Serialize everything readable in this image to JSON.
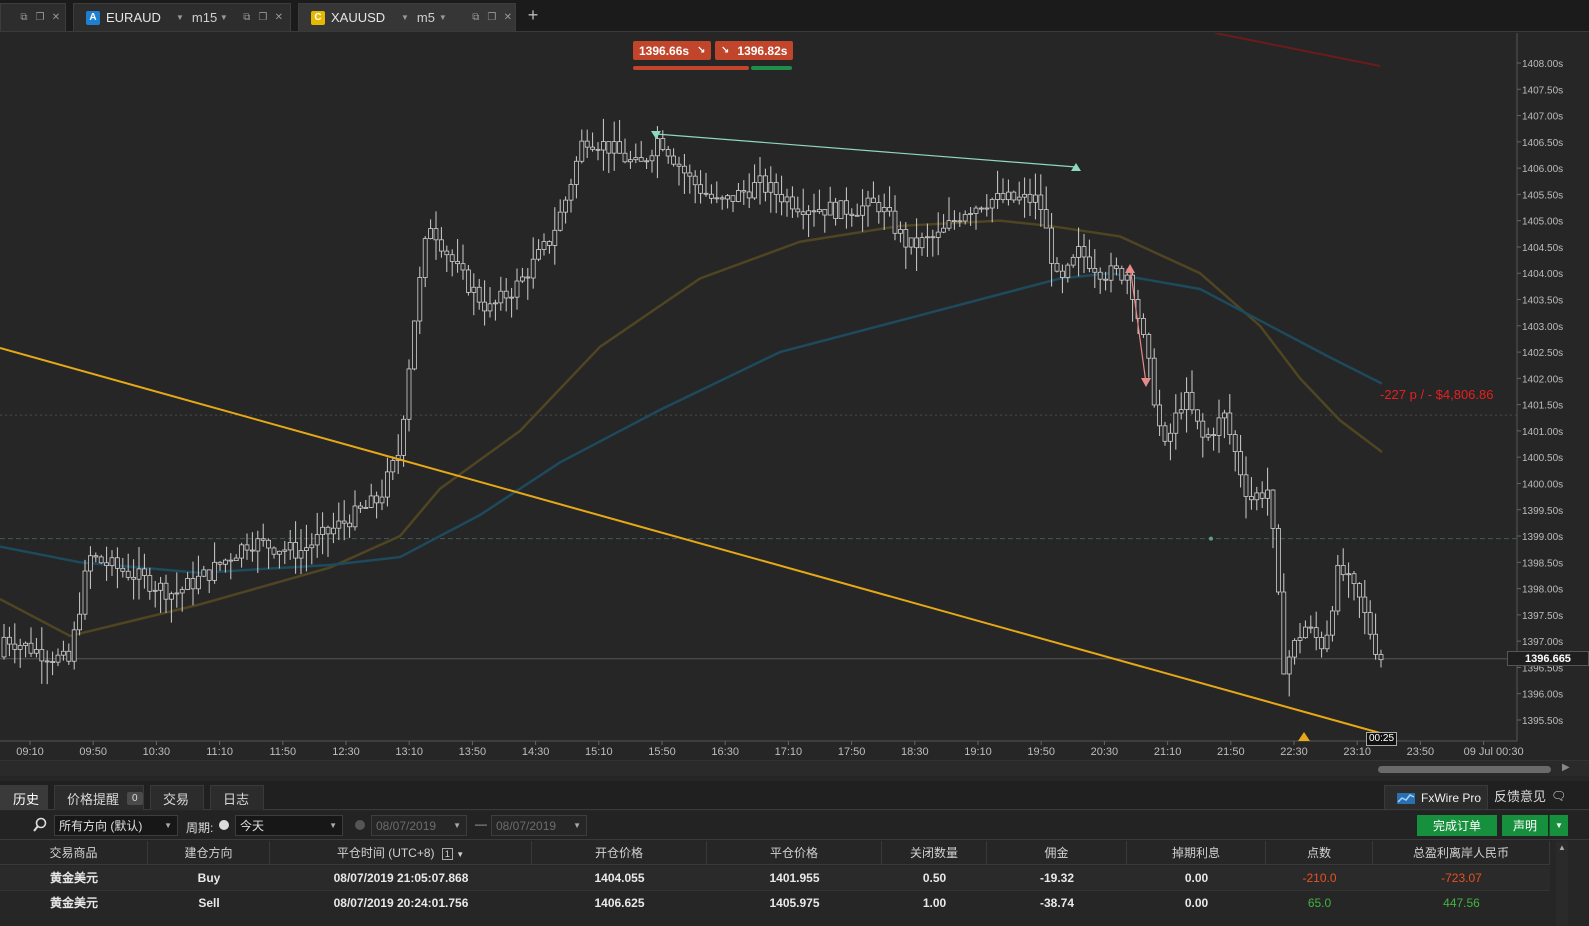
{
  "tabs": [
    {
      "badge": "",
      "symbol": "",
      "timeframe": ""
    },
    {
      "badge": "A",
      "symbol": "EURAUD",
      "timeframe": "m15",
      "badge_color": "#1e7fd1"
    },
    {
      "badge": "C",
      "symbol": "XAUUSD",
      "timeframe": "m5",
      "badge_color": "#e6b800"
    }
  ],
  "chart": {
    "bid_label": "1396.66s",
    "ask_label": "1396.82s",
    "pl_label": "-227 p / - $4,806.86",
    "current_price": "1396.665",
    "timer": "00:25",
    "price_axis": [
      "1408.00s",
      "1407.50s",
      "1407.00s",
      "1406.50s",
      "1406.00s",
      "1405.50s",
      "1405.00s",
      "1404.50s",
      "1404.00s",
      "1403.50s",
      "1403.00s",
      "1402.50s",
      "1402.00s",
      "1401.50s",
      "1401.00s",
      "1400.50s",
      "1400.00s",
      "1399.50s",
      "1399.00s",
      "1398.50s",
      "1398.00s",
      "1397.50s",
      "1397.00s",
      "1396.50s",
      "1396.00s",
      "1395.50s"
    ],
    "time_axis": [
      "09:10",
      "09:50",
      "10:30",
      "11:10",
      "11:50",
      "12:30",
      "13:10",
      "13:50",
      "14:30",
      "15:10",
      "15:50",
      "16:30",
      "17:10",
      "17:50",
      "18:30",
      "19:10",
      "19:50",
      "20:30",
      "21:10",
      "21:50",
      "22:30",
      "23:10",
      "23:50",
      "09 Jul 00:30"
    ],
    "colors": {
      "bid": "#c1452b",
      "trendline": "#e6a817",
      "ma_slow": "#1d4a5c",
      "ma_fast": "#4f4522"
    }
  },
  "panel_tabs": [
    {
      "label": "历史"
    },
    {
      "label": "价格提醒",
      "count": "0"
    },
    {
      "label": "交易"
    },
    {
      "label": "日志"
    }
  ],
  "fxwire_label": "FxWire Pro",
  "feedback_label": "反馈意见",
  "filters": {
    "direction": "所有方向 (默认)",
    "period_label": "周期:",
    "period": "今天",
    "date_from": "08/07/2019",
    "date_to": "08/07/2019",
    "complete_order": "完成订单",
    "statement": "声明"
  },
  "table": {
    "columns": [
      "交易商品",
      "建仓方向",
      "平仓时间 (UTC+8)",
      "开仓价格",
      "平仓价格",
      "关闭数量",
      "佣金",
      "掉期利息",
      "点数",
      "总盈利离岸人民币"
    ],
    "sort_badge": "1",
    "rows": [
      [
        "黄金美元",
        "Buy",
        "08/07/2019 21:05:07.868",
        "1404.055",
        "1401.955",
        "0.50",
        "-19.32",
        "0.00",
        "-210.0",
        "-723.07"
      ],
      [
        "黄金美元",
        "Sell",
        "08/07/2019 20:24:01.756",
        "1406.625",
        "1405.975",
        "1.00",
        "-38.74",
        "0.00",
        "65.0",
        "447.56"
      ]
    ]
  }
}
